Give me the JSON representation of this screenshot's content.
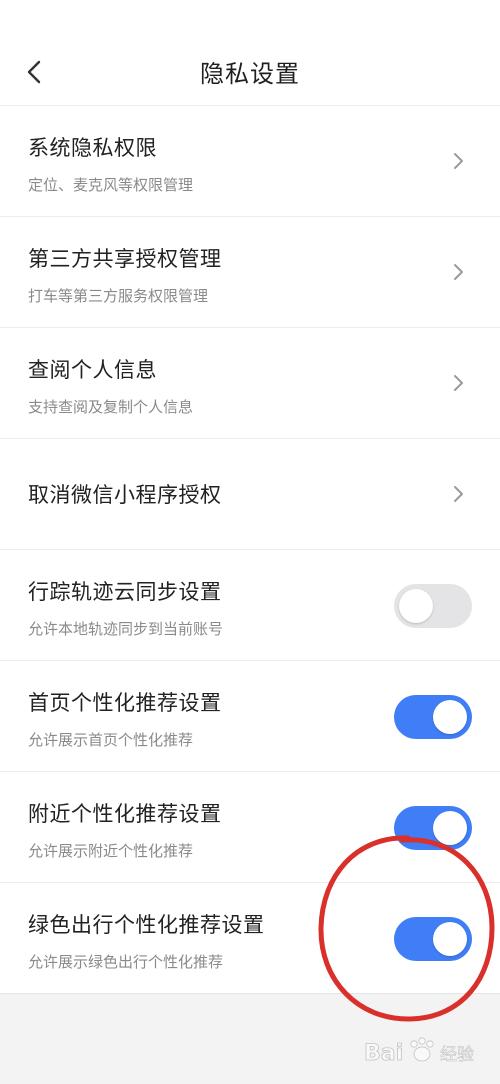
{
  "header": {
    "title": "隐私设置",
    "back_icon": "chevron-left-icon"
  },
  "items": [
    {
      "title": "系统隐私权限",
      "subtitle": "定位、麦克风等权限管理",
      "control": "chevron"
    },
    {
      "title": "第三方共享授权管理",
      "subtitle": "打车等第三方服务权限管理",
      "control": "chevron"
    },
    {
      "title": "查阅个人信息",
      "subtitle": "支持查阅及复制个人信息",
      "control": "chevron"
    },
    {
      "title": "取消微信小程序授权",
      "subtitle": "",
      "control": "chevron"
    },
    {
      "title": "行踪轨迹云同步设置",
      "subtitle": "允许本地轨迹同步到当前账号",
      "control": "toggle",
      "on": false
    },
    {
      "title": "首页个性化推荐设置",
      "subtitle": "允许展示首页个性化推荐",
      "control": "toggle",
      "on": true
    },
    {
      "title": "附近个性化推荐设置",
      "subtitle": "允许展示附近个性化推荐",
      "control": "toggle",
      "on": true
    },
    {
      "title": "绿色出行个性化推荐设置",
      "subtitle": "允许展示绿色出行个性化推荐",
      "control": "toggle",
      "on": true
    }
  ],
  "colors": {
    "toggle_on": "#3f7ef6",
    "toggle_off": "#e4e4e6",
    "annotation": "#d9302b",
    "background": "#f3f3f4"
  },
  "watermark": {
    "text": "Bai经验"
  }
}
